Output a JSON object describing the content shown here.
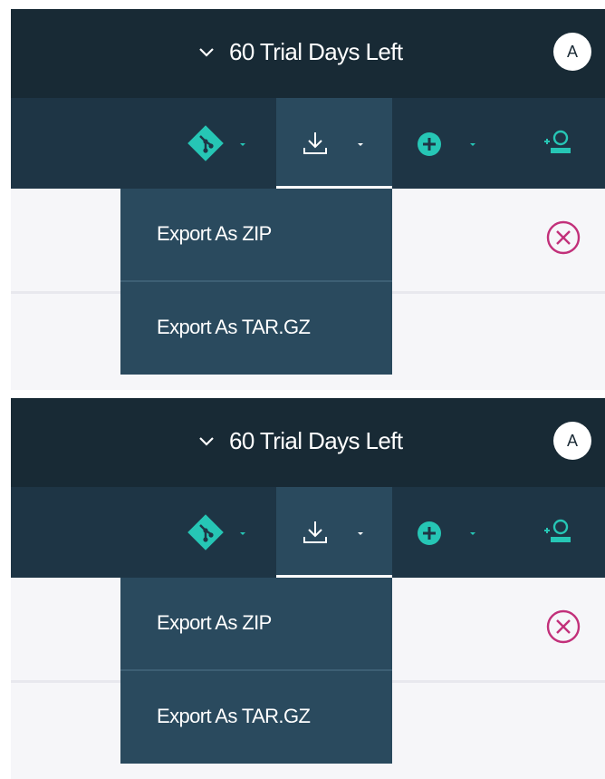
{
  "panels": [
    {
      "header": {
        "trial_label": "60 Trial Days Left",
        "avatar_initial": "A"
      },
      "toolbar": {
        "git_icon": "git-icon",
        "download_icon": "download-icon",
        "add_icon": "plus-circle-icon",
        "add_user_icon": "add-user-icon",
        "active": "download"
      },
      "export_menu": {
        "items": [
          "Export As ZIP",
          "Export As TAR.GZ"
        ]
      },
      "close_icon": "close-circle-icon"
    },
    {
      "header": {
        "trial_label": "60 Trial Days Left",
        "avatar_initial": "A"
      },
      "toolbar": {
        "git_icon": "git-icon",
        "download_icon": "download-icon",
        "add_icon": "plus-circle-icon",
        "add_user_icon": "add-user-icon",
        "active": "download"
      },
      "export_menu": {
        "items": [
          "Export As ZIP",
          "Export As TAR.GZ"
        ]
      },
      "close_icon": "close-circle-icon"
    }
  ],
  "colors": {
    "header_bg": "#182a35",
    "toolbar_bg": "#1e3545",
    "menu_bg": "#2a4a5e",
    "accent_teal": "#26c6b5",
    "close_magenta": "#c2307a"
  }
}
